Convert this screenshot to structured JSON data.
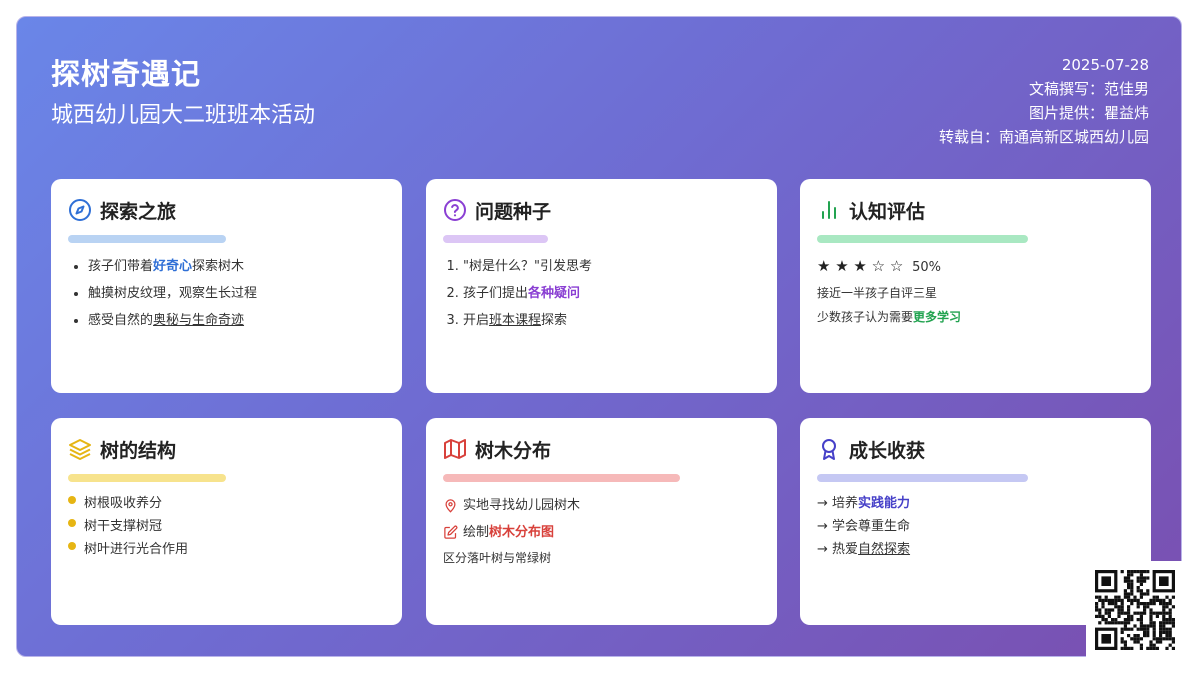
{
  "header": {
    "title": "探树奇遇记",
    "subtitle": "城西幼儿园大二班班本活动",
    "date": "2025-07-28",
    "author": "文稿撰写：范佳男",
    "photos": "图片提供：瞿益炜",
    "source": "转载自：南通高新区城西幼儿园"
  },
  "cards": {
    "explore": {
      "title": "探索之旅",
      "icon": "compass-icon",
      "bar_color": "#b9d3f3",
      "items": [
        {
          "pre": "孩子们带着",
          "em": "好奇心",
          "post": "探索树木"
        },
        {
          "text": "触摸树皮纹理，观察生长过程"
        },
        {
          "pre": "感受自然的",
          "em": "奥秘与生命奇迹",
          "post": ""
        }
      ]
    },
    "questions": {
      "title": "问题种子",
      "icon": "question-circle-icon",
      "bar_color": "#dcc6f5",
      "items": [
        {
          "text": "\"树是什么？\"引发思考"
        },
        {
          "pre": "孩子们提出",
          "em": "各种疑问",
          "post": ""
        },
        {
          "pre": "开启",
          "em": "班本课程",
          "post": "探索"
        }
      ]
    },
    "assessment": {
      "title": "认知评估",
      "icon": "bar-chart-icon",
      "bar_color": "#a9e8c2",
      "stars": "★ ★ ★ ☆ ☆",
      "percent": "50%",
      "rating_fraction": 0.5,
      "line1": "接近一半孩子自评三星",
      "line2_pre": "少数孩子认为需要",
      "line2_em": "更多学习"
    },
    "structure": {
      "title": "树的结构",
      "icon": "layers-icon",
      "bar_color": "#f7e38d",
      "items": [
        "树根吸收养分",
        "树干支撑树冠",
        "树叶进行光合作用"
      ]
    },
    "distribution": {
      "title": "树木分布",
      "icon": "map-icon",
      "bar_color": "#f6b9b9",
      "item1": "实地寻找幼儿园树木",
      "item2_pre": "绘制",
      "item2_em": "树木分布图",
      "item3": "区分落叶树与常绿树"
    },
    "growth": {
      "title": "成长收获",
      "icon": "award-icon",
      "bar_color": "#c5c8f3",
      "items": [
        {
          "pre": "→ 培养",
          "em": "实践能力",
          "post": ""
        },
        {
          "text": "→ 学会尊重生命"
        },
        {
          "pre": "→ 热爱",
          "em": "自然探索",
          "post": ""
        }
      ]
    }
  }
}
